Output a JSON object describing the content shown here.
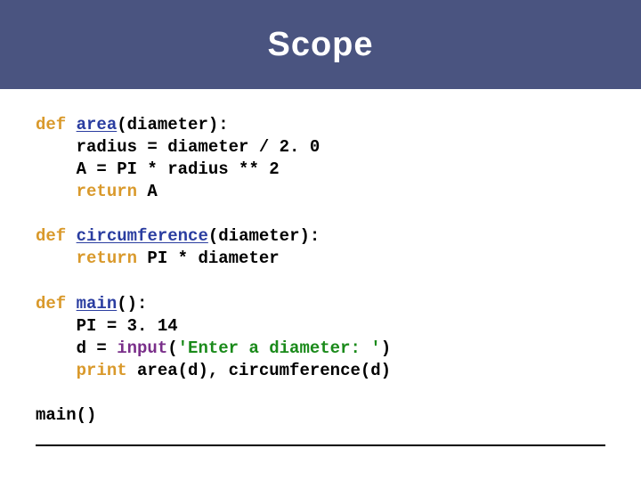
{
  "title": "Scope",
  "code": {
    "l1_def": "def",
    "l1_fn": "area",
    "l1_rest": "(diameter):",
    "l2": "    radius = diameter / 2. 0",
    "l3": "    A = PI * radius ** 2",
    "l4_ret": "    return",
    "l4_rest": " A",
    "l6_def": "def",
    "l6_fn": "circumference",
    "l6_rest": "(diameter):",
    "l7_ret": "    return",
    "l7_rest": " PI * diameter",
    "l9_def": "def",
    "l9_fn": "main",
    "l9_rest": "():",
    "l10": "    PI = 3. 14",
    "l11_a": "    d = ",
    "l11_bi": "input",
    "l11_b": "(",
    "l11_str": "'Enter a diameter: '",
    "l11_c": ")",
    "l12_print": "    print",
    "l12_rest": " area(d), circumference(d)",
    "l14": "main()"
  }
}
